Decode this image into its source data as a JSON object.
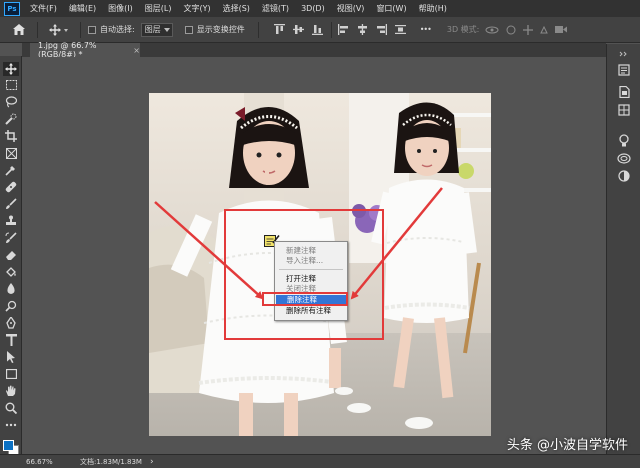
{
  "app": {
    "logo": "Ps",
    "menu": [
      "文件(F)",
      "编辑(E)",
      "图像(I)",
      "图层(L)",
      "文字(Y)",
      "选择(S)",
      "滤镜(T)",
      "3D(D)",
      "视图(V)",
      "窗口(W)",
      "帮助(H)"
    ]
  },
  "options": {
    "auto_select_label": "自动选择:",
    "auto_select_value": "图层",
    "show_transform_label": "显示变换控件",
    "mode_3d_label": "3D 模式:",
    "more": "•••"
  },
  "document": {
    "tab_title": "1.jpg @ 66.7%(RGB/8#) *",
    "close": "×"
  },
  "context_menu": {
    "items": [
      {
        "label": "新建注释",
        "state": "disabled"
      },
      {
        "label": "导入注释...",
        "state": "disabled"
      },
      {
        "label": "打开注释",
        "state": "enabled"
      },
      {
        "label": "关闭注释",
        "state": "disabled"
      },
      {
        "label": "删除注释",
        "state": "highlighted"
      },
      {
        "label": "删除所有注释",
        "state": "enabled"
      }
    ]
  },
  "status": {
    "zoom": "66.67%",
    "doc_info": "文档:1.83M/1.83M",
    "arrow": "›"
  },
  "watermark": "头条 @小波自学软件",
  "colors": {
    "foreground": "#0c71c3",
    "background": "#ffffff",
    "highlight_box": "#e23a3a",
    "menu_highlight": "#3375d6"
  }
}
